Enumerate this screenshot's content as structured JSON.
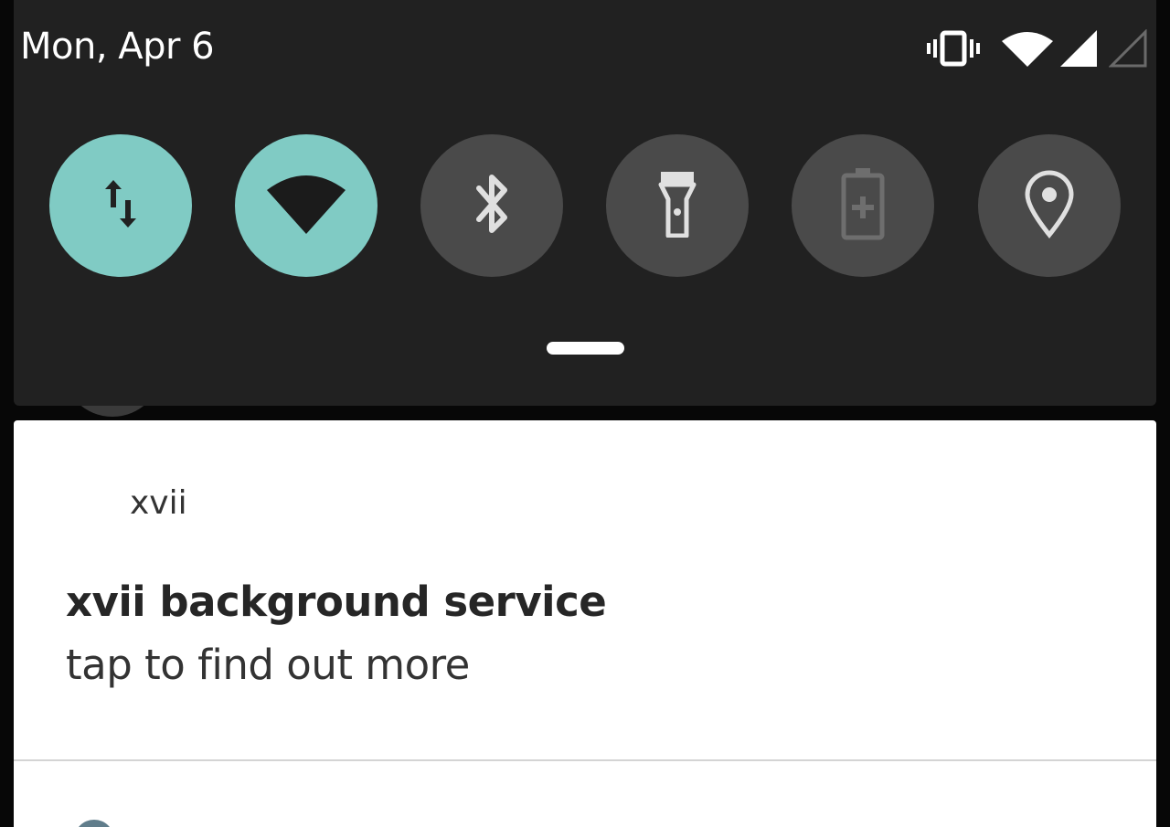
{
  "status_bar": {
    "date": "Mon, Apr 6",
    "icons": [
      "vibrate-icon",
      "wifi-signal-icon",
      "cell-signal-icon",
      "cell-signal-empty-icon"
    ]
  },
  "quick_settings": {
    "tiles": [
      {
        "name": "mobile-data",
        "icon": "data-transfer-icon",
        "state": "on"
      },
      {
        "name": "wifi",
        "icon": "wifi-icon",
        "state": "on"
      },
      {
        "name": "bluetooth",
        "icon": "bluetooth-icon",
        "state": "off"
      },
      {
        "name": "flashlight",
        "icon": "flashlight-icon",
        "state": "off"
      },
      {
        "name": "battery-saver",
        "icon": "battery-saver-icon",
        "state": "off"
      },
      {
        "name": "location",
        "icon": "location-icon",
        "state": "off"
      }
    ],
    "colors": {
      "active": "#80cbc4",
      "inactive": "#4a4a4a",
      "panel": "#212121"
    }
  },
  "notification": {
    "app_name": "xvii",
    "title": "xvii background service",
    "text": "tap to find out more"
  }
}
